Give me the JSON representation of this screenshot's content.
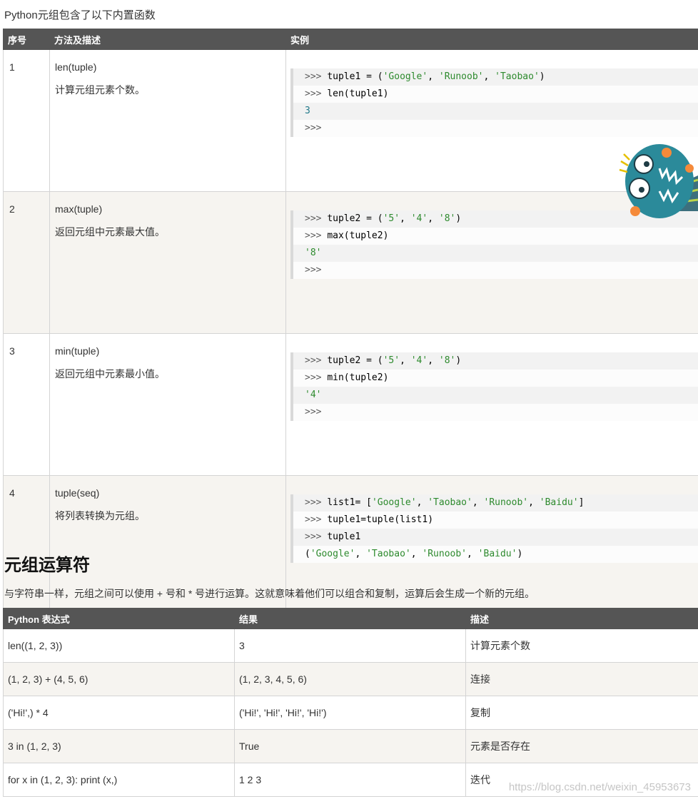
{
  "intro": "Python元组包含了以下内置函数",
  "functions_table": {
    "headers": [
      "序号",
      "方法及描述",
      "实例"
    ],
    "rows": [
      {
        "num": "1",
        "method": "len(tuple)",
        "desc": "计算元组元素个数。",
        "code": [
          [
            [
              "p",
              ">>> "
            ],
            [
              "t",
              "tuple1 = ("
            ],
            [
              "s",
              "'Google'"
            ],
            [
              "t",
              ", "
            ],
            [
              "s",
              "'Runoob'"
            ],
            [
              "t",
              ", "
            ],
            [
              "s",
              "'Taobao'"
            ],
            [
              "t",
              ")"
            ]
          ],
          [
            [
              "p",
              ">>> "
            ],
            [
              "t",
              "len(tuple1)"
            ]
          ],
          [
            [
              "n",
              "3"
            ]
          ],
          [
            [
              "p",
              ">>>"
            ]
          ]
        ]
      },
      {
        "num": "2",
        "method": "max(tuple)",
        "desc": "返回元组中元素最大值。",
        "code": [
          [
            [
              "p",
              ">>> "
            ],
            [
              "t",
              "tuple2 = ("
            ],
            [
              "s",
              "'5'"
            ],
            [
              "t",
              ", "
            ],
            [
              "s",
              "'4'"
            ],
            [
              "t",
              ", "
            ],
            [
              "s",
              "'8'"
            ],
            [
              "t",
              ")"
            ]
          ],
          [
            [
              "p",
              ">>> "
            ],
            [
              "t",
              "max(tuple2)"
            ]
          ],
          [
            [
              "s",
              "'8'"
            ]
          ],
          [
            [
              "p",
              ">>>"
            ]
          ]
        ]
      },
      {
        "num": "3",
        "method": "min(tuple)",
        "desc": "返回元组中元素最小值。",
        "code": [
          [
            [
              "p",
              ">>> "
            ],
            [
              "t",
              "tuple2 = ("
            ],
            [
              "s",
              "'5'"
            ],
            [
              "t",
              ", "
            ],
            [
              "s",
              "'4'"
            ],
            [
              "t",
              ", "
            ],
            [
              "s",
              "'8'"
            ],
            [
              "t",
              ")"
            ]
          ],
          [
            [
              "p",
              ">>> "
            ],
            [
              "t",
              "min(tuple2)"
            ]
          ],
          [
            [
              "s",
              "'4'"
            ]
          ],
          [
            [
              "p",
              ">>>"
            ]
          ]
        ]
      },
      {
        "num": "4",
        "method": "tuple(seq)",
        "desc": "将列表转换为元组。",
        "code": [
          [
            [
              "p",
              ">>> "
            ],
            [
              "t",
              "list1= ["
            ],
            [
              "s",
              "'Google'"
            ],
            [
              "t",
              ", "
            ],
            [
              "s",
              "'Taobao'"
            ],
            [
              "t",
              ", "
            ],
            [
              "s",
              "'Runoob'"
            ],
            [
              "t",
              ", "
            ],
            [
              "s",
              "'Baidu'"
            ],
            [
              "t",
              "]"
            ]
          ],
          [
            [
              "p",
              ">>> "
            ],
            [
              "t",
              "tuple1=tuple(list1)"
            ]
          ],
          [
            [
              "p",
              ">>> "
            ],
            [
              "t",
              "tuple1"
            ]
          ],
          [
            [
              "t",
              "("
            ],
            [
              "s",
              "'Google'"
            ],
            [
              "t",
              ", "
            ],
            [
              "s",
              "'Taobao'"
            ],
            [
              "t",
              ", "
            ],
            [
              "s",
              "'Runoob'"
            ],
            [
              "t",
              ", "
            ],
            [
              "s",
              "'Baidu'"
            ],
            [
              "t",
              ")"
            ]
          ]
        ]
      }
    ]
  },
  "operators_section": {
    "heading": "元组运算符",
    "description": "与字符串一样，元组之间可以使用 + 号和 * 号进行运算。这就意味着他们可以组合和复制，运算后会生成一个新的元组。",
    "headers": [
      "Python 表达式",
      "结果",
      "描述"
    ],
    "rows": [
      [
        "len((1, 2, 3))",
        "3",
        "计算元素个数"
      ],
      [
        "(1, 2, 3) + (4, 5, 6)",
        "(1, 2, 3, 4, 5, 6)",
        "连接"
      ],
      [
        "('Hi!',) * 4",
        "('Hi!', 'Hi!', 'Hi!', 'Hi!')",
        "复制"
      ],
      [
        "3 in (1, 2, 3)",
        "True",
        "元素是否存在"
      ],
      [
        "for x in (1, 2, 3): print (x,)",
        "1 2 3",
        "迭代"
      ]
    ]
  },
  "watermark": "https://blog.csdn.net/weixin_45953673",
  "colors": {
    "header_bg": "#555555",
    "alt_row_bg": "#f6f4f0",
    "code_string": "#2d8a2d",
    "code_number": "#227a8a",
    "mascot_teal": "#2b8a9a",
    "mascot_orange": "#f58a3a"
  },
  "icons": {
    "mascot": "monster-mascot-icon"
  }
}
